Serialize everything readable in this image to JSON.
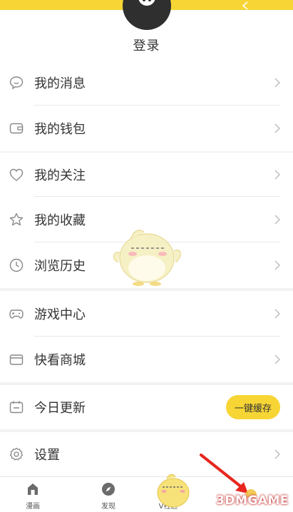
{
  "header": {
    "login_label": "登录"
  },
  "menu": {
    "messages": {
      "label": "我的消息",
      "icon": "chat-bubble-icon"
    },
    "wallet": {
      "label": "我的钱包",
      "icon": "wallet-icon"
    },
    "follows": {
      "label": "我的关注",
      "icon": "heart-icon"
    },
    "favorites": {
      "label": "我的收藏",
      "icon": "star-icon"
    },
    "history": {
      "label": "浏览历史",
      "icon": "clock-icon"
    },
    "games": {
      "label": "游戏中心",
      "icon": "gamepad-icon"
    },
    "mall": {
      "label": "快看商城",
      "icon": "shop-icon"
    },
    "updates": {
      "label": "今日更新",
      "icon": "calendar-icon",
      "action_label": "一键缓存"
    },
    "settings": {
      "label": "设置",
      "icon": "gear-icon"
    }
  },
  "tabbar": {
    "items": [
      {
        "label": "漫画",
        "icon": "home-icon"
      },
      {
        "label": "发现",
        "icon": "compass-icon"
      },
      {
        "label": "V社区",
        "icon": "community-mascot-icon"
      }
    ]
  },
  "watermark": "3DMGAME",
  "colors": {
    "accent": "#f7d534",
    "background": "#f2f2f2",
    "text": "#333333",
    "annotation_arrow": "#e8261f"
  }
}
